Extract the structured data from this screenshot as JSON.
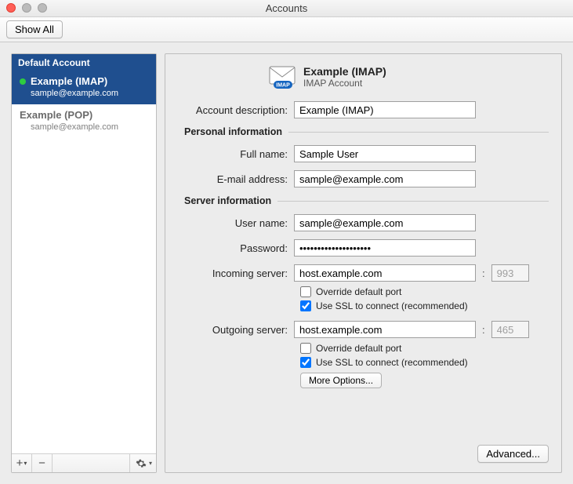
{
  "window": {
    "title": "Accounts",
    "show_all": "Show All"
  },
  "sidebar": {
    "section_header": "Default Account",
    "accounts": [
      {
        "name": "Example (IMAP)",
        "email": "sample@example.com",
        "selected": true
      },
      {
        "name": "Example (POP)",
        "email": "sample@example.com",
        "selected": false
      }
    ],
    "add_label": "+",
    "remove_label": "−"
  },
  "detail": {
    "header_title": "Example (IMAP)",
    "header_subtitle": "IMAP Account",
    "labels": {
      "account_description": "Account description:",
      "personal_info": "Personal information",
      "full_name": "Full name:",
      "email": "E-mail address:",
      "server_info": "Server information",
      "user_name": "User name:",
      "password": "Password:",
      "incoming": "Incoming server:",
      "outgoing": "Outgoing server:",
      "override_port": "Override default port",
      "use_ssl": "Use SSL to connect (recommended)",
      "more_options": "More Options...",
      "advanced": "Advanced..."
    },
    "values": {
      "account_description": "Example (IMAP)",
      "full_name": "Sample User",
      "email": "sample@example.com",
      "user_name": "sample@example.com",
      "password": "••••••••••••••••••••",
      "incoming_server": "host.example.com",
      "incoming_port": "993",
      "outgoing_server": "host.example.com",
      "outgoing_port": "465"
    },
    "checks": {
      "incoming_override": false,
      "incoming_ssl": true,
      "outgoing_override": false,
      "outgoing_ssl": true
    }
  }
}
